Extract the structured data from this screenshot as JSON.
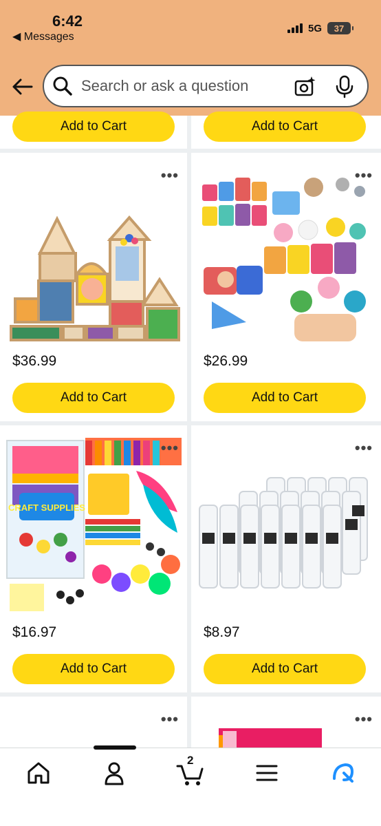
{
  "status_bar": {
    "time": "6:42",
    "back_app": "◀ Messages",
    "network": "5G",
    "battery": "37"
  },
  "search": {
    "placeholder": "Search or ask a question"
  },
  "top_row": [
    {
      "button_label": "Add to Cart"
    },
    {
      "button_label": "Add to Cart"
    }
  ],
  "products": [
    {
      "price": "$36.99",
      "button_label": "Add to Cart",
      "image": "wooden-rainbow-blocks"
    },
    {
      "price": "$26.99",
      "button_label": "Add to Cart",
      "image": "animal-train-toy"
    },
    {
      "price": "$16.97",
      "button_label": "Add to Cart",
      "image": "craft-supplies"
    },
    {
      "price": "$8.97",
      "button_label": "Add to Cart",
      "image": "glue-sticks"
    }
  ],
  "craft_package_label": "CRAFT SUPPLIES",
  "more_options_label": "•••",
  "bottom_nav": {
    "cart_count": "2",
    "items": [
      "home-icon",
      "account-icon",
      "cart-icon",
      "menu-icon",
      "rufus-icon"
    ]
  },
  "colors": {
    "header": "#f0b27e",
    "add_to_cart": "#ffd814",
    "rufus_accent": "#1e90ff"
  }
}
